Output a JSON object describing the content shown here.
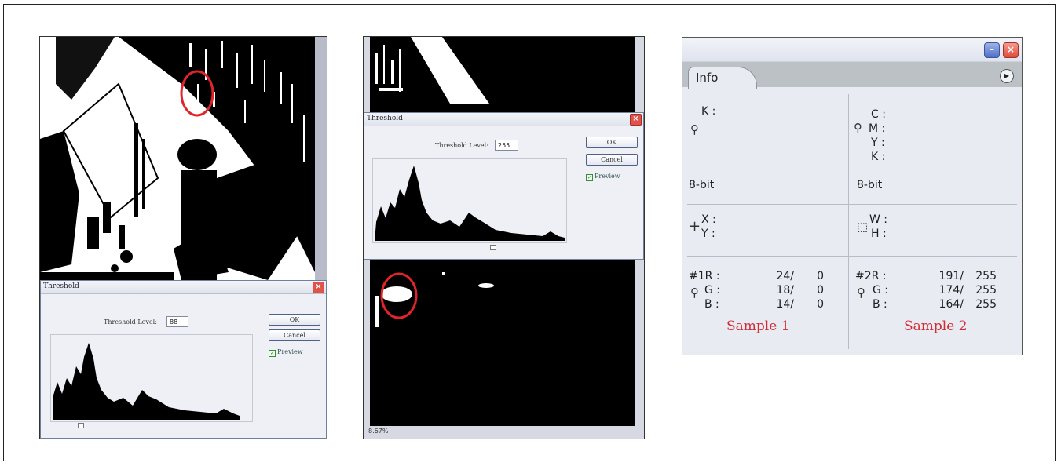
{
  "left_dialog": {
    "title": "Threshold",
    "level_label": "Threshold Level:",
    "level_value": "88",
    "ok_label": "OK",
    "cancel_label": "Cancel",
    "preview_label": "Preview",
    "preview_checked": true
  },
  "middle_dialog": {
    "title": "Threshold",
    "level_label": "Threshold Level:",
    "level_value": "255",
    "ok_label": "OK",
    "cancel_label": "Cancel",
    "preview_label": "Preview",
    "preview_checked": true
  },
  "middle_status": {
    "zoom": "8.67%"
  },
  "info_panel": {
    "tab": "Info",
    "left_top": {
      "k": "K :",
      "bitdepth": "8-bit"
    },
    "right_top": {
      "c": "C :",
      "m": "M :",
      "y": "Y :",
      "k": "K :",
      "bitdepth": "8-bit"
    },
    "xy": {
      "x": "X :",
      "y": "Y :"
    },
    "wh": {
      "w": "W :",
      "h": "H :"
    },
    "sample1": {
      "r_label": "#1R :",
      "g_label": "G :",
      "b_label": "B :",
      "r": "24/",
      "r2": "0",
      "g": "18/",
      "g2": "0",
      "b": "14/",
      "b2": "0",
      "caption": "Sample 1"
    },
    "sample2": {
      "r_label": "#2R :",
      "g_label": "G :",
      "b_label": "B :",
      "r": "191/",
      "r2": "255",
      "g": "174/",
      "g2": "255",
      "b": "164/",
      "b2": "255",
      "caption": "Sample 2"
    }
  },
  "colors": {
    "accent_red": "#d12b34",
    "panel_bg": "#e9ebf3"
  }
}
